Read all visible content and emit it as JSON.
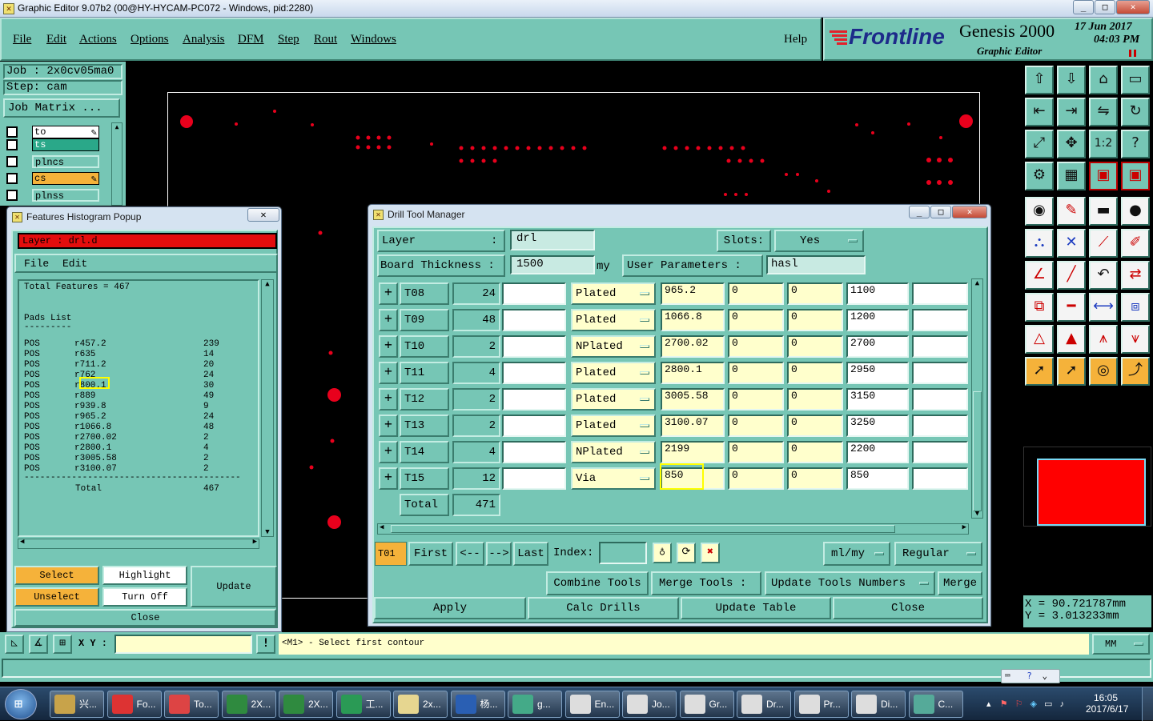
{
  "app": {
    "title": "Graphic Editor 9.07b2 (00@HY-HYCAM-PC072 - Windows, pid:2280)",
    "min": "_",
    "max": "□",
    "close": "✕"
  },
  "menu": {
    "items": [
      "File",
      "Edit",
      "Actions",
      "Options",
      "Analysis",
      "DFM",
      "Step",
      "Rout",
      "Windows"
    ],
    "help": "Help"
  },
  "brand": {
    "logo": "Frontline",
    "product": "Genesis 2000",
    "subtitle": "Graphic Editor",
    "date": "17 Jun 2017",
    "time": "04:03 PM"
  },
  "job": {
    "job_label": "Job : 2x0cv05ma0",
    "step_label": "Step: cam",
    "matrix_button": "Job Matrix ...",
    "layers": [
      {
        "name": "to",
        "color": "#ffffff"
      },
      {
        "name": "ts",
        "color": "#2aa889"
      },
      {
        "name": "plncs",
        "color": "#76c6b5"
      },
      {
        "name": "cs",
        "color": "#f5b23a"
      },
      {
        "name": "plnss",
        "color": "#76c6b5"
      }
    ]
  },
  "histogram": {
    "window_title": "Features Histogram Popup",
    "layer_label": "Layer :  drl.d",
    "menu_file": "File",
    "menu_edit": "Edit",
    "total_features": "Total Features = 467",
    "pads_title": "Pads List",
    "pads_underline": "---------",
    "rows": [
      {
        "pol": "POS",
        "sym": "r457.2",
        "count": "239"
      },
      {
        "pol": "POS",
        "sym": "r635",
        "count": "14"
      },
      {
        "pol": "POS",
        "sym": "r711.2",
        "count": "20"
      },
      {
        "pol": "POS",
        "sym": "r762",
        "count": "24"
      },
      {
        "pol": "POS",
        "sym": "r800.1",
        "count": "30"
      },
      {
        "pol": "POS",
        "sym": "r889",
        "count": "49"
      },
      {
        "pol": "POS",
        "sym": "r939.8",
        "count": "9"
      },
      {
        "pol": "POS",
        "sym": "r965.2",
        "count": "24"
      },
      {
        "pol": "POS",
        "sym": "r1066.8",
        "count": "48"
      },
      {
        "pol": "POS",
        "sym": "r2700.02",
        "count": "2"
      },
      {
        "pol": "POS",
        "sym": "r2800.1",
        "count": "4"
      },
      {
        "pol": "POS",
        "sym": "r3005.58",
        "count": "2"
      },
      {
        "pol": "POS",
        "sym": "r3100.07",
        "count": "2"
      }
    ],
    "separator": "-----------------------------------------",
    "total_label": "Total",
    "total_value": "467",
    "buttons": {
      "select": "Select",
      "highlight": "Highlight",
      "update": "Update",
      "unselect": "Unselect",
      "turn_off": "Turn Off",
      "close": "Close"
    }
  },
  "drill": {
    "window_title": "Drill Tool Manager",
    "layer_label": "Layer",
    "layer_colon": ":",
    "layer_value": "drl",
    "slots_label": "Slots:",
    "slots_value": "Yes",
    "thickness_label": "Board Thickness  :",
    "thickness_value": "1500",
    "thickness_unit": "my",
    "user_params_label": "User Parameters  :",
    "user_params_value": "hasl",
    "tools": [
      {
        "id": "T08",
        "count": "24",
        "type": "Plated",
        "finish": "965.2",
        "plus": "0",
        "minus": "0",
        "drill": "1100"
      },
      {
        "id": "T09",
        "count": "48",
        "type": "Plated",
        "finish": "1066.8",
        "plus": "0",
        "minus": "0",
        "drill": "1200"
      },
      {
        "id": "T10",
        "count": "2",
        "type": "NPlated",
        "finish": "2700.02",
        "plus": "0",
        "minus": "0",
        "drill": "2700"
      },
      {
        "id": "T11",
        "count": "4",
        "type": "Plated",
        "finish": "2800.1",
        "plus": "0",
        "minus": "0",
        "drill": "2950"
      },
      {
        "id": "T12",
        "count": "2",
        "type": "Plated",
        "finish": "3005.58",
        "plus": "0",
        "minus": "0",
        "drill": "3150"
      },
      {
        "id": "T13",
        "count": "2",
        "type": "Plated",
        "finish": "3100.07",
        "plus": "0",
        "minus": "0",
        "drill": "3250"
      },
      {
        "id": "T14",
        "count": "4",
        "type": "NPlated",
        "finish": "2199",
        "plus": "0",
        "minus": "0",
        "drill": "2200"
      },
      {
        "id": "T15",
        "count": "12",
        "type": "Via",
        "finish": "850",
        "plus": "0",
        "minus": "0",
        "drill": "850"
      }
    ],
    "total_label": "Total",
    "total_value": "471",
    "nav": {
      "current": "T01",
      "first": "First",
      "prev": "<--",
      "next": "-->",
      "last": "Last",
      "index_label": "Index:",
      "units": "ml/my",
      "mode": "Regular"
    },
    "combine": "Combine Tools",
    "merge_tools_label": "Merge Tools :",
    "merge_option": "Update Tools Numbers",
    "merge": "Merge",
    "apply": "Apply",
    "calc": "Calc Drills",
    "update_table": "Update Table",
    "close": "Close"
  },
  "coords": {
    "x": "X = 90.721787mm",
    "y": "Y = 3.013233mm"
  },
  "status": {
    "xy_label": "X Y :",
    "message": "<M1> - Select first contour",
    "units": "MM"
  },
  "taskbar": {
    "items": [
      "兴...",
      "Fo...",
      "To...",
      "2X...",
      "2X...",
      "工...",
      "2x...",
      "杨...",
      "g...",
      "En...",
      "Jo...",
      "Gr...",
      "Dr...",
      "Pr...",
      "Di...",
      "C..."
    ],
    "clock_time": "16:05",
    "clock_date": "2017/6/17"
  }
}
